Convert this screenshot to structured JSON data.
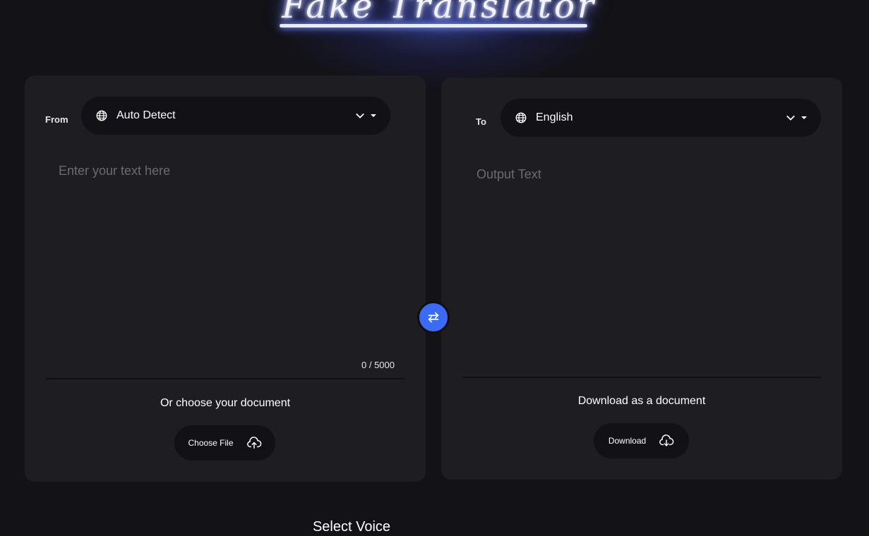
{
  "app": {
    "title": "Fake Translator"
  },
  "source": {
    "label": "From",
    "language": "Auto Detect",
    "placeholder": "Enter your text here",
    "counter": "0 / 5000",
    "document_heading": "Or choose your document",
    "choose_file_label": "Choose File"
  },
  "target": {
    "label": "To",
    "language": "English",
    "output_placeholder": "Output Text",
    "document_heading": "Download as a document",
    "download_label": "Download"
  },
  "voice": {
    "heading": "Select Voice"
  },
  "icons": {
    "globe": "globe-icon",
    "chevron": "chevron-down-icon",
    "swap": "swap-arrows-icon",
    "upload": "cloud-upload-icon",
    "download": "cloud-download-icon"
  },
  "colors": {
    "background": "#131217",
    "panel": "#1e1d22",
    "accent": "#3b6bf5"
  }
}
